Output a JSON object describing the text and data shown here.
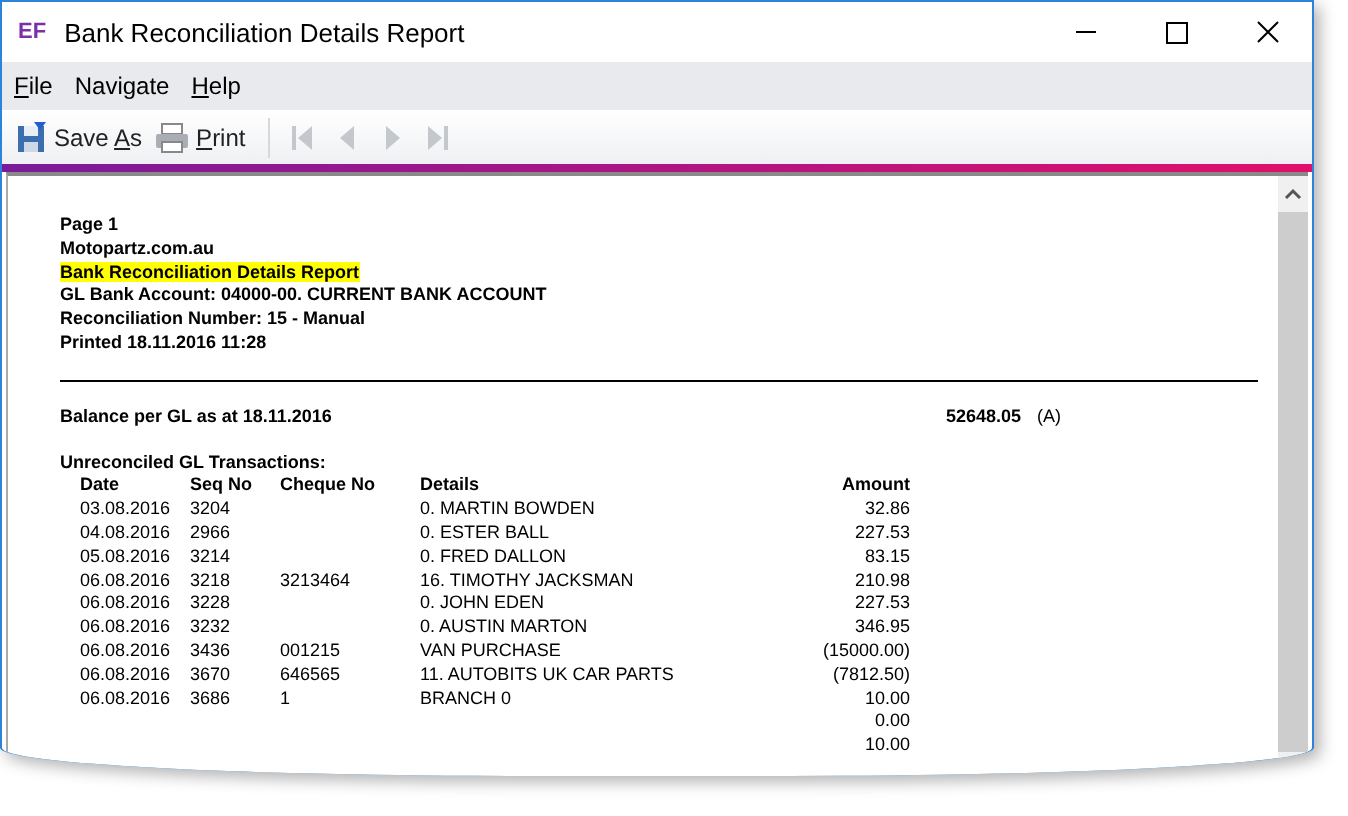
{
  "window": {
    "title": "Bank Reconciliation Details Report",
    "logo": "EF"
  },
  "menu": [
    {
      "accel": "F",
      "rest": "ile"
    },
    {
      "rest": "Navigate"
    },
    {
      "accel": "H",
      "rest": "elp"
    }
  ],
  "toolbar": {
    "save_as": {
      "before": "Save ",
      "accel": "A",
      "rest": "s"
    },
    "print": {
      "accel": "P",
      "rest": "rint"
    }
  },
  "report": {
    "page": "Page 1",
    "company": "Motopartz.com.au",
    "title": "Bank Reconciliation Details Report",
    "account": "GL Bank Account: 04000-00. CURRENT BANK ACCOUNT",
    "recon_number": "Reconciliation Number: 15 - Manual",
    "printed": "Printed 18.11.2016 11:28",
    "balance_label": "Balance per GL as at 18.11.2016",
    "balance_value": "52648.05",
    "balance_flag": "(A)",
    "section": "Unreconciled GL Transactions:",
    "columns": [
      "Date",
      "Seq No",
      "Cheque No",
      "Details",
      "Amount"
    ],
    "rows": [
      {
        "date": "03.08.2016",
        "seq": "3204",
        "details": "0. MARTIN BOWDEN",
        "amount": "32.86"
      },
      {
        "date": "04.08.2016",
        "seq": "2966",
        "details": "0. ESTER BALL",
        "amount": "227.53"
      },
      {
        "date": "05.08.2016",
        "seq": "3214",
        "details": "0. FRED DALLON",
        "amount": "83.15"
      },
      {
        "date": "06.08.2016",
        "seq": "3218",
        "cheque": "3213464",
        "details": "16. TIMOTHY JACKSMAN",
        "amount": "210.98"
      },
      {
        "date": "06.08.2016",
        "seq": "3228",
        "details": "0. JOHN EDEN",
        "amount": "227.53"
      },
      {
        "date": "06.08.2016",
        "seq": "3232",
        "details": "0. AUSTIN MARTON",
        "amount": "346.95"
      },
      {
        "date": "06.08.2016",
        "seq": "3436",
        "cheque": "001215",
        "details": "VAN PURCHASE",
        "amount": "(15000.00)"
      },
      {
        "date": "06.08.2016",
        "seq": "3670",
        "cheque": "646565",
        "details": "11. AUTOBITS UK CAR PARTS",
        "amount": "(7812.50)"
      },
      {
        "date": "06.08.2016",
        "seq": "3686",
        "cheque": "1",
        "details": "BRANCH 0",
        "amount": "10.00"
      },
      {
        "amount": "0.00"
      },
      {
        "amount": "10.00"
      }
    ]
  }
}
